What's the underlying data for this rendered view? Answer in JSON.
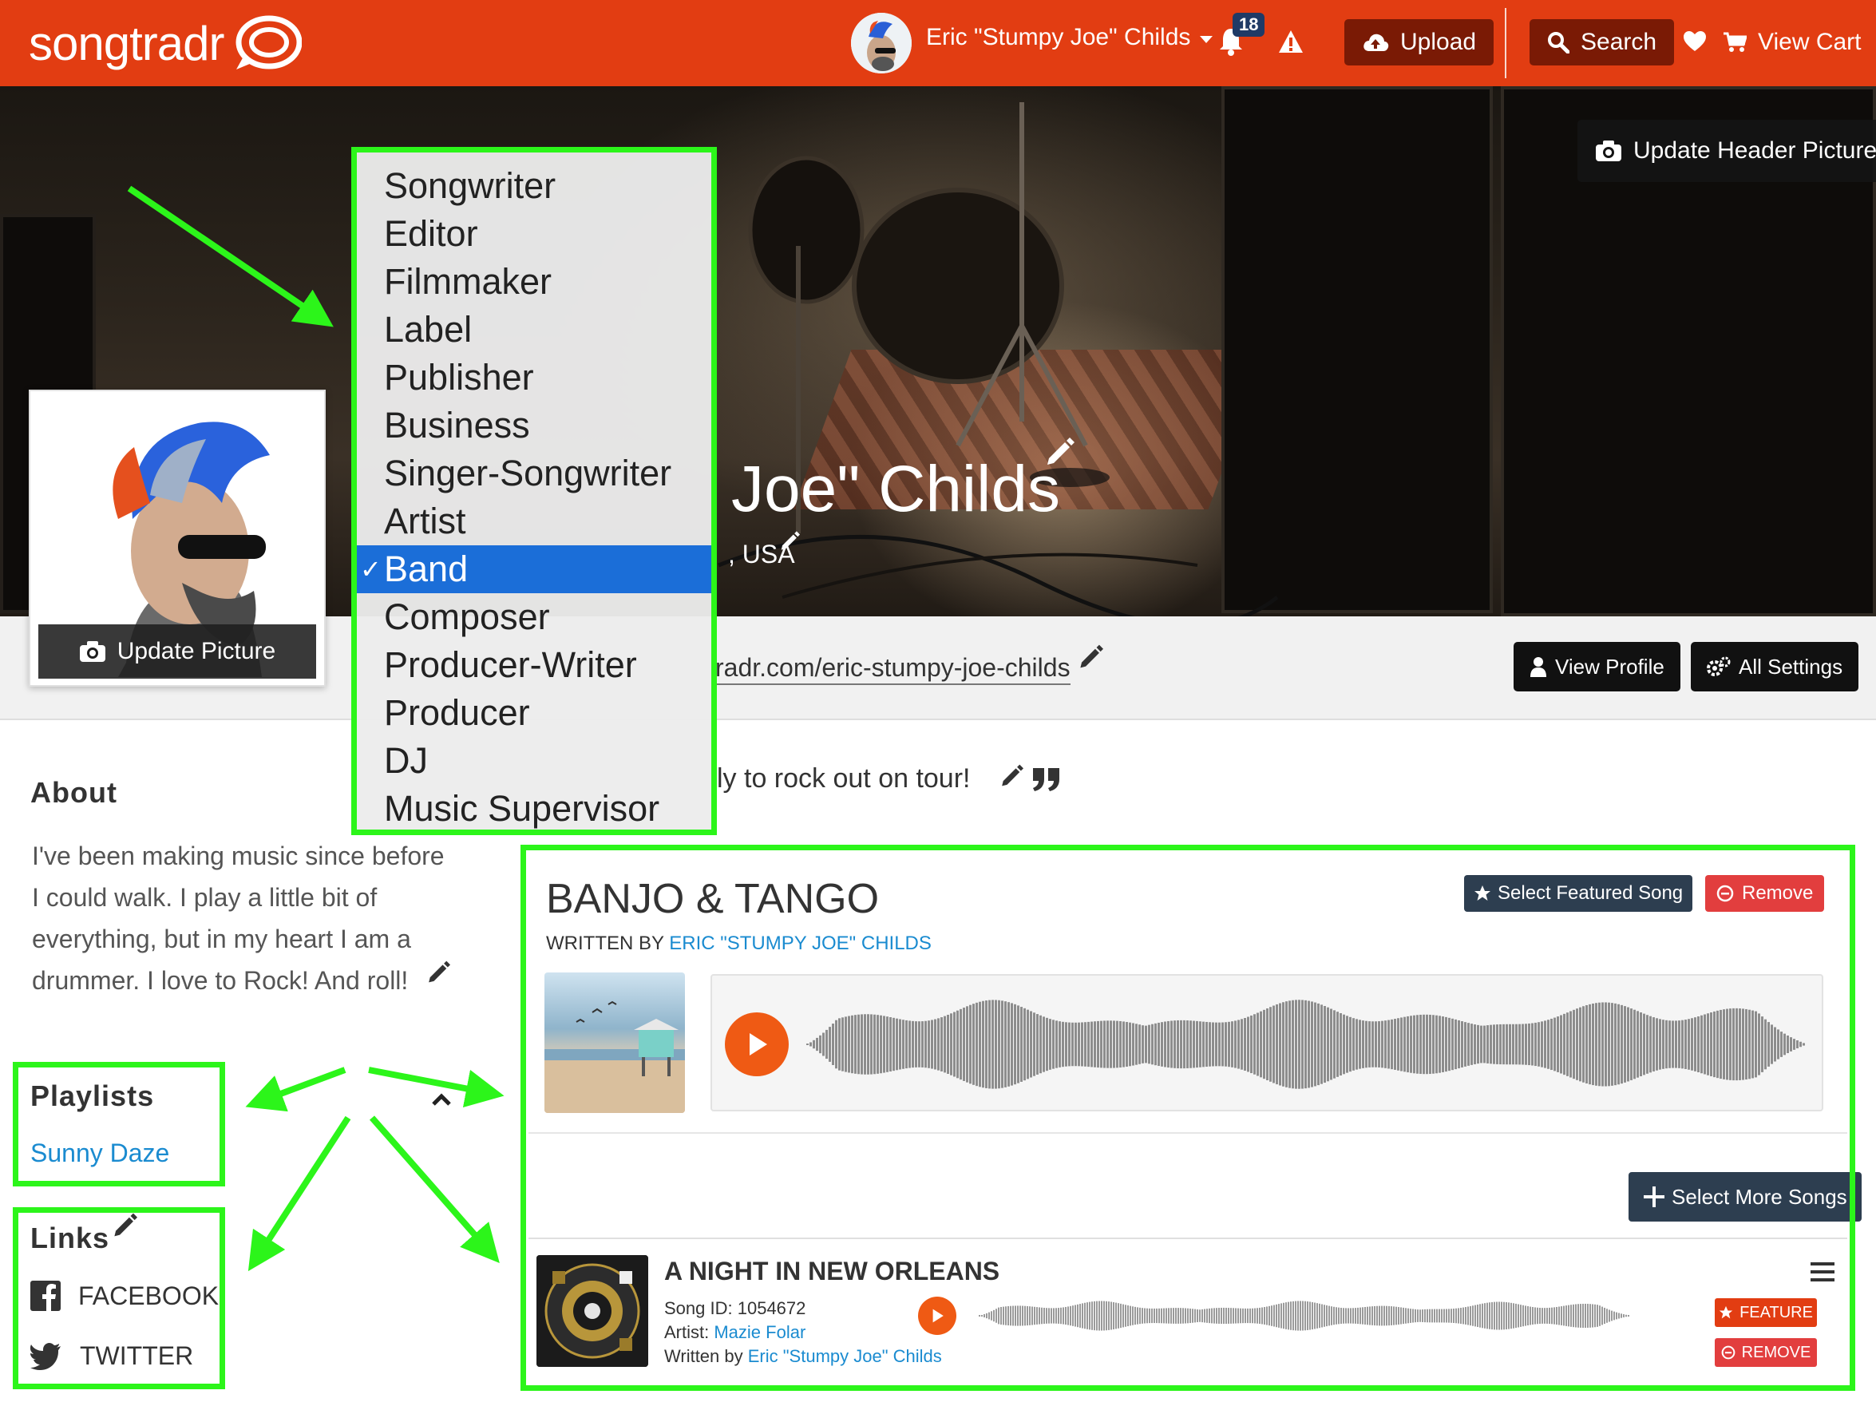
{
  "navbar": {
    "logo_text": "songtradr",
    "user_name": "Eric \"Stumpy Joe\" Childs",
    "notification_count": "18",
    "upload_label": "Upload",
    "search_label": "Search",
    "cart_label": "View Cart",
    "brand_color": "#e23d12"
  },
  "header": {
    "update_header_label": "Update Header Picture",
    "name_visible": "Joe\" Childs",
    "location_visible": ", USA",
    "update_picture_label": "Update Picture"
  },
  "url_bar": {
    "profile_url_visible": "radr.com/eric-stumpy-joe-childs",
    "view_profile_label": "View Profile",
    "all_settings_label": "All Settings"
  },
  "role_dropdown": {
    "options": [
      "Songwriter",
      "Editor",
      "Filmmaker",
      "Label",
      "Publisher",
      "Business",
      "Singer-Songwriter",
      "Artist",
      "Band",
      "Composer",
      "Producer-Writer",
      "Producer",
      "DJ",
      "Music Supervisor"
    ],
    "selected": "Band",
    "check_mark": "✓"
  },
  "about": {
    "title": "About",
    "lines": [
      "I've been making music since before",
      "I could walk. I play a little bit of",
      "everything, but in my heart I am a",
      "drummer. I love to Rock! And roll!"
    ],
    "tagline_visible": "ly to rock out on tour!"
  },
  "playlists": {
    "title": "Playlists",
    "items": [
      "Sunny Daze"
    ]
  },
  "links": {
    "title": "Links",
    "items": [
      {
        "label": "FACEBOOK",
        "icon": "facebook-icon"
      },
      {
        "label": "TWITTER",
        "icon": "twitter-icon"
      }
    ]
  },
  "featured_song": {
    "title": "BANJO & TANGO",
    "written_by_label": "WRITTEN BY",
    "writer": "ERIC \"STUMPY JOE\" CHILDS",
    "select_featured_label": "Select Featured Song",
    "remove_label": "Remove"
  },
  "more_songs_label": "Select More Songs",
  "song_rows": [
    {
      "title": "A NIGHT IN NEW ORLEANS",
      "song_id_label": "Song ID:",
      "song_id": "1054672",
      "artist_label": "Artist:",
      "artist": "Mazie Folar",
      "written_by_label": "Written by",
      "writer": "Eric \"Stumpy Joe\" Childs",
      "feature_label": "FEATURE",
      "remove_label": "REMOVE"
    }
  ],
  "colors": {
    "highlight": "#2cf51a",
    "accent_orange": "#ef5a14",
    "link_blue": "#1a8bd0",
    "selected_blue": "#1b6ed8",
    "remove_red": "#e23e3e",
    "navy_button": "#2d3e50"
  }
}
